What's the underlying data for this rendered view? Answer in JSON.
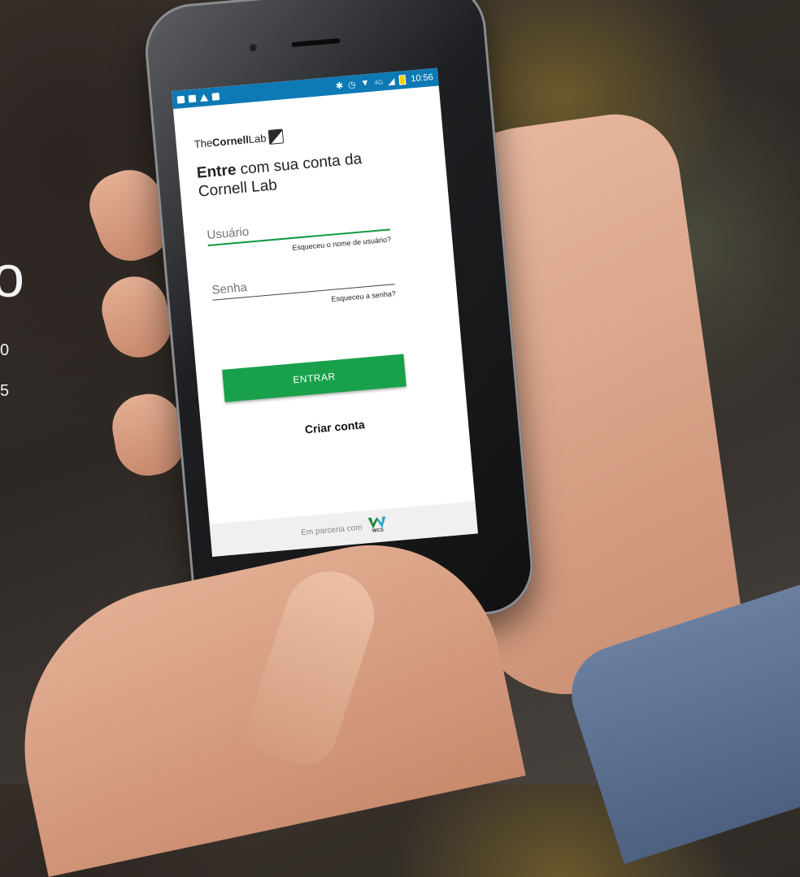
{
  "background": {
    "big_glyph": "o",
    "small_lines": [
      "0",
      "5"
    ]
  },
  "status_bar": {
    "network": "4G",
    "time": "10:56"
  },
  "logo": {
    "prefix": "The",
    "bold": "Cornell",
    "suffix": "Lab"
  },
  "heading": {
    "bold": "Entre",
    "rest": "com sua conta da Cornell Lab"
  },
  "form": {
    "username_placeholder": "Usuário",
    "forgot_username": "Esqueceu o nome de usuário?",
    "password_placeholder": "Senha",
    "forgot_password": "Esqueceu a senha?",
    "submit_label": "ENTRAR",
    "create_account": "Criar conta"
  },
  "footer": {
    "partner_text": "Em parceria com",
    "partner_logo_text": "WCS"
  },
  "colors": {
    "status_bar": "#0d7ab5",
    "primary_green": "#18a14a"
  }
}
